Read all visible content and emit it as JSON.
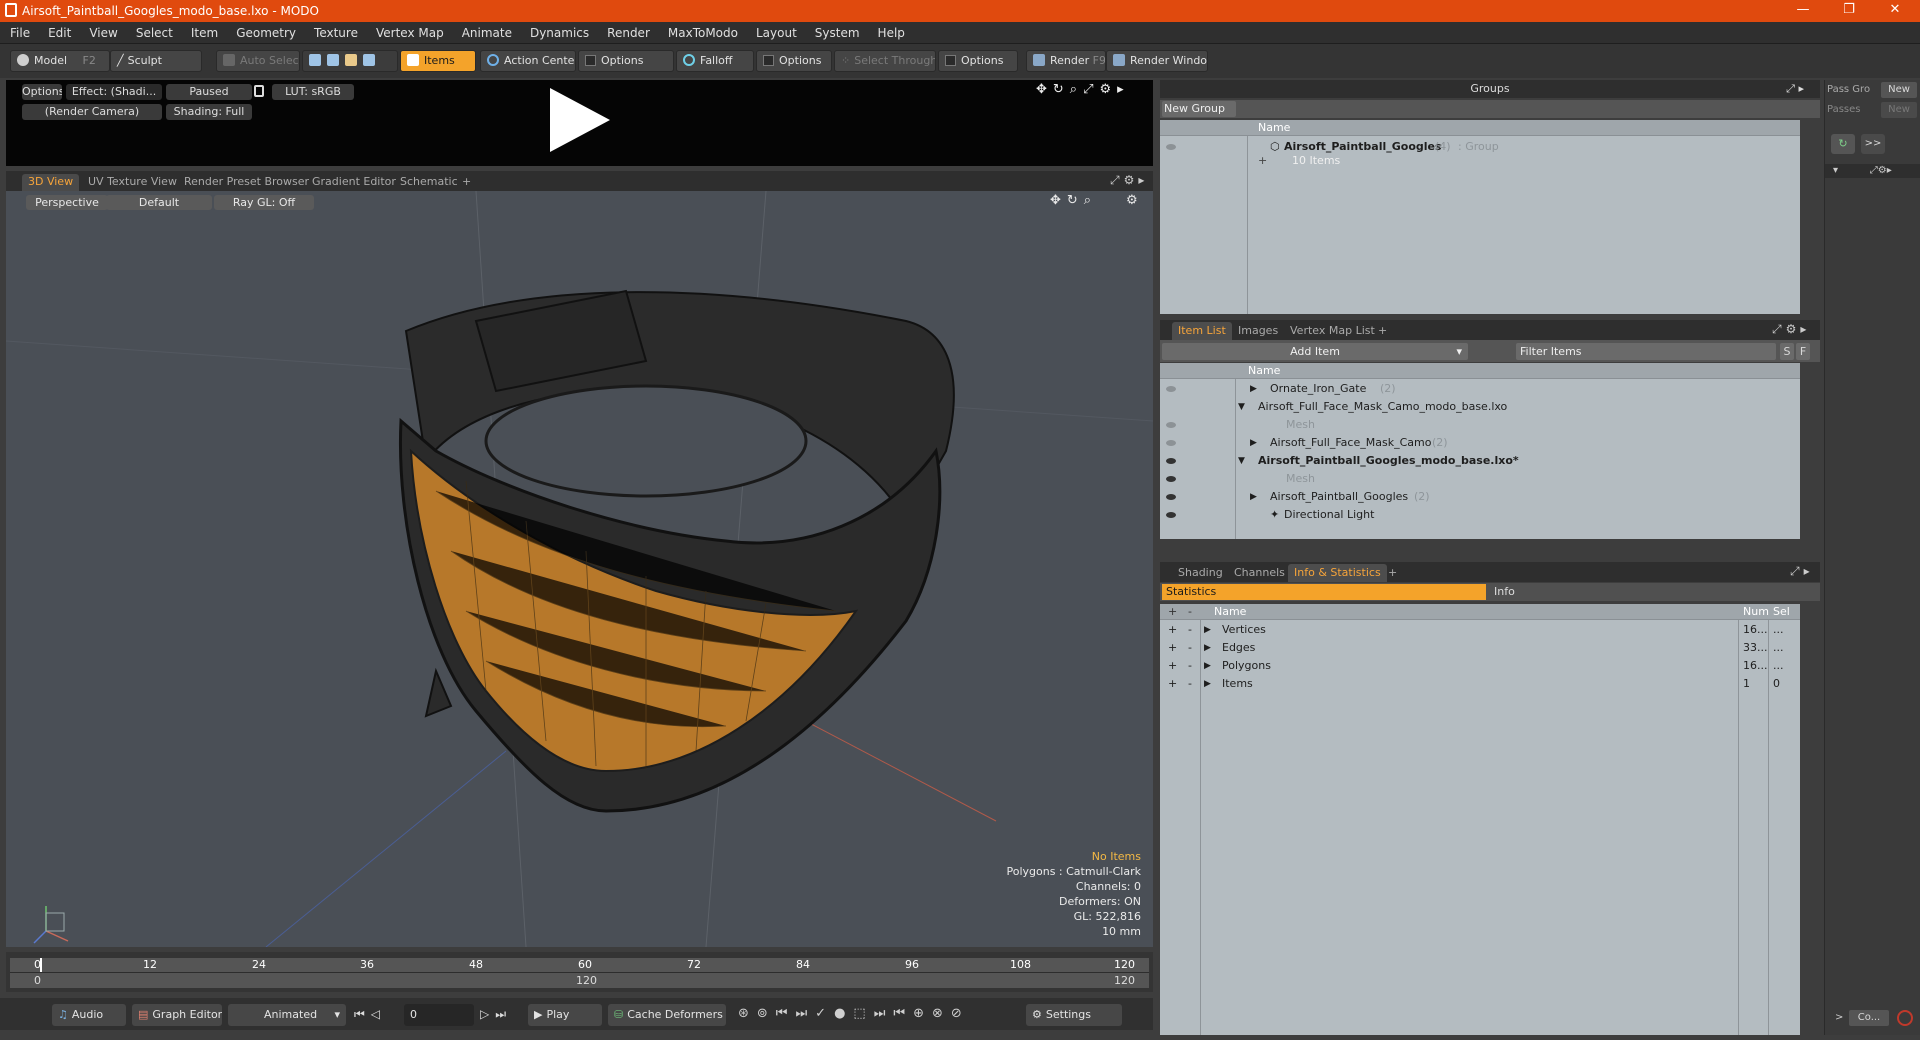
{
  "window": {
    "title": "Airsoft_Paintball_Googles_modo_base.lxo - MODO",
    "controls": [
      "—",
      "❐",
      "✕"
    ]
  },
  "menu": [
    "File",
    "Edit",
    "View",
    "Select",
    "Item",
    "Geometry",
    "Texture",
    "Vertex Map",
    "Animate",
    "Dynamics",
    "Render",
    "MaxToModo",
    "Layout",
    "System",
    "Help"
  ],
  "toolbar": {
    "model": "Model",
    "model_key": "F2",
    "sculpt": "Sculpt",
    "auto_select": "Auto Select",
    "items": "Items",
    "action_center": "Action Center",
    "options1": "Options",
    "falloff": "Falloff",
    "options2": "Options",
    "select_through": "Select Through",
    "options3": "Options",
    "render": "Render",
    "render_key": "F9",
    "render_window": "Render Window"
  },
  "preview": {
    "options": "Options",
    "effect": "Effect: (Shadi...",
    "paused": "Paused",
    "lut": "LUT: sRGB",
    "camera": "(Render Camera)",
    "shading": "Shading: Full"
  },
  "viewport_tabs": [
    "3D View",
    "UV Texture View",
    "Render Preset Browser",
    "Gradient Editor",
    "Schematic",
    "+"
  ],
  "viewport": {
    "perspective": "Perspective",
    "default": "Default",
    "raygl": "Ray GL: Off",
    "info": {
      "no_items": "No Items",
      "polygons": "Polygons : Catmull-Clark",
      "channels": "Channels: 0",
      "deformers": "Deformers: ON",
      "gl": "GL: 522,816",
      "unit": "10 mm"
    },
    "colors": {
      "bg": "#4a4f56",
      "lens": "#b7782a",
      "frame": "#2b2b2b"
    }
  },
  "timeline": {
    "ticks": [
      "0",
      "12",
      "24",
      "36",
      "48",
      "60",
      "72",
      "84",
      "96",
      "108",
      "120"
    ],
    "sub_ticks": [
      "0",
      "120",
      "120"
    ]
  },
  "bottom": {
    "audio": "Audio",
    "graph_editor": "Graph Editor",
    "animated": "Animated",
    "frame": "0",
    "play": "Play",
    "cache": "Cache Deformers",
    "settings": "Settings"
  },
  "groups": {
    "header": "Groups",
    "new_group": "New Group",
    "col_name": "Name",
    "item_name": "Airsoft_Paintball_Googles",
    "item_count": "(4)",
    "item_type": ": Group",
    "item_sub": "10 Items"
  },
  "pass": {
    "pass_groups": "Pass Gro",
    "new1": "New",
    "passes": "Passes",
    "new2": "New",
    "more": ">>"
  },
  "itemlist": {
    "tabs": [
      "Item List",
      "Images",
      "Vertex Map List",
      "+"
    ],
    "add_item": "Add Item",
    "filter": "Filter Items",
    "s": "S",
    "f": "F",
    "col_name": "Name",
    "rows": [
      {
        "label": "Ornate_Iron_Gate",
        "suffix": "(2)"
      },
      {
        "label": "Airsoft_Full_Face_Mask_Camo_modo_base.lxo",
        "suffix": ""
      },
      {
        "label": "Mesh",
        "suffix": ""
      },
      {
        "label": "Airsoft_Full_Face_Mask_Camo",
        "suffix": "(2)"
      },
      {
        "label": "Airsoft_Paintball_Googles_modo_base.lxo*",
        "suffix": ""
      },
      {
        "label": "Mesh",
        "suffix": ""
      },
      {
        "label": "Airsoft_Paintball_Googles",
        "suffix": "(2)"
      },
      {
        "label": "Directional Light",
        "suffix": ""
      }
    ]
  },
  "stats": {
    "tabs": [
      "Shading",
      "Channels",
      "Info & Statistics",
      "+"
    ],
    "statistics": "Statistics",
    "info": "Info",
    "col_name": "Name",
    "col_num": "Num",
    "col_sel": "Sel",
    "rows": [
      {
        "name": "Vertices",
        "num": "16...",
        "sel": "..."
      },
      {
        "name": "Edges",
        "num": "33...",
        "sel": "..."
      },
      {
        "name": "Polygons",
        "num": "16...",
        "sel": "..."
      },
      {
        "name": "Items",
        "num": "1",
        "sel": "0"
      }
    ]
  },
  "right_strip": {
    "bottom_btn": "Co..."
  }
}
